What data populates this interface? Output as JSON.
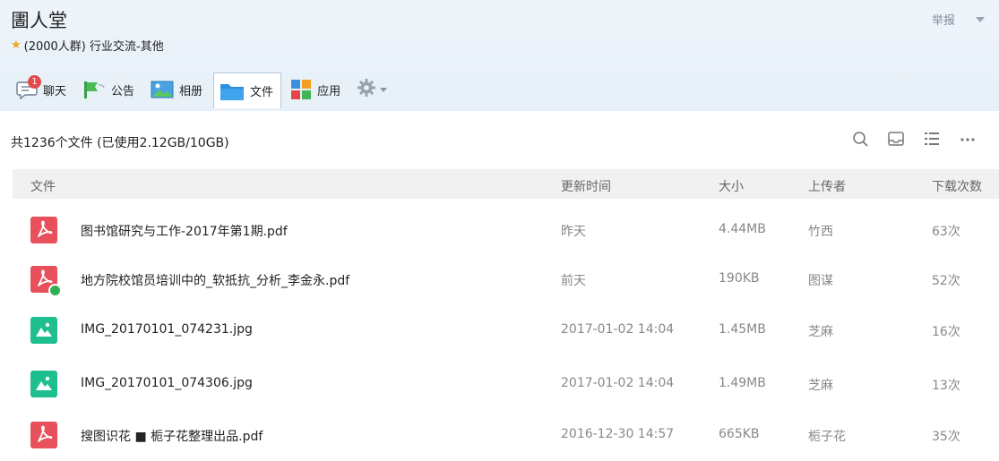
{
  "header": {
    "title": "圕人堂",
    "group_info": "(2000人群) 行业交流-其他",
    "report_label": "举报"
  },
  "tabs": [
    {
      "label": "聊天",
      "icon": "chat-icon",
      "badge": "1"
    },
    {
      "label": "公告",
      "icon": "megaphone-icon"
    },
    {
      "label": "相册",
      "icon": "photo-icon"
    },
    {
      "label": "文件",
      "icon": "folder-icon",
      "active": true
    },
    {
      "label": "应用",
      "icon": "apps-icon"
    }
  ],
  "summary": "共1236个文件 (已使用2.12GB/10GB)",
  "columns": {
    "file": "文件",
    "time": "更新时间",
    "size": "大小",
    "uploader": "上传者",
    "downloads": "下载次数"
  },
  "files": [
    {
      "name": "图书馆研究与工作-2017年第1期.pdf",
      "time": "昨天",
      "size": "4.44MB",
      "uploader": "竹西",
      "downloads": "63次",
      "type": "pdf",
      "downloaded": false
    },
    {
      "name": "地方院校馆员培训中的_软抵抗_分析_李金永.pdf",
      "time": "前天",
      "size": "190KB",
      "uploader": "图谋",
      "downloads": "52次",
      "type": "pdf",
      "downloaded": true
    },
    {
      "name": "IMG_20170101_074231.jpg",
      "time": "2017-01-02 14:04",
      "size": "1.45MB",
      "uploader": "芝麻",
      "downloads": "16次",
      "type": "image",
      "downloaded": false
    },
    {
      "name": "IMG_20170101_074306.jpg",
      "time": "2017-01-02 14:04",
      "size": "1.49MB",
      "uploader": "芝麻",
      "downloads": "13次",
      "type": "image",
      "downloaded": false
    },
    {
      "name": "搜图识花 ■ 栀子花整理出品.pdf",
      "time": "2016-12-30 14:57",
      "size": "665KB",
      "uploader": "栀子花",
      "downloads": "35次",
      "type": "pdf",
      "downloaded": false
    }
  ],
  "colors": {
    "pdf": "#e8505b",
    "image": "#1fbe8e",
    "check": "#2fb153",
    "badge": "#e34a4a"
  }
}
